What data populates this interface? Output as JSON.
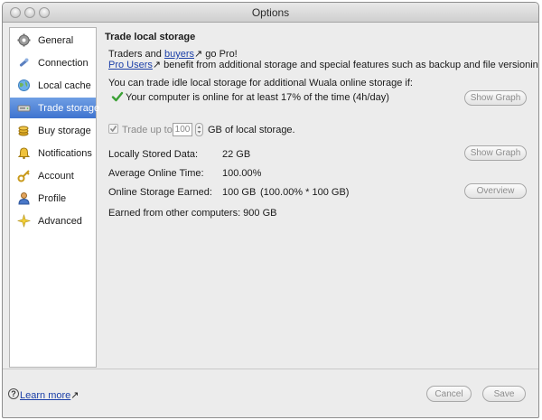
{
  "window": {
    "title": "Options"
  },
  "sidebar": {
    "items": [
      {
        "label": "General",
        "icon": "gear-icon"
      },
      {
        "label": "Connection",
        "icon": "satellite-icon"
      },
      {
        "label": "Local cache",
        "icon": "globe-icon"
      },
      {
        "label": "Trade storage",
        "icon": "drive-icon"
      },
      {
        "label": "Buy storage",
        "icon": "coins-icon"
      },
      {
        "label": "Notifications",
        "icon": "bell-icon"
      },
      {
        "label": "Account",
        "icon": "key-icon"
      },
      {
        "label": "Profile",
        "icon": "person-icon"
      },
      {
        "label": "Advanced",
        "icon": "sparkle-icon"
      }
    ],
    "selected": "Trade storage"
  },
  "main": {
    "heading": "Trade local storage",
    "intro_prefix": "Traders and ",
    "intro_link": "buyers",
    "intro_suffix": " go Pro!",
    "pro_link": "Pro Users",
    "pro_suffix": " benefit from additional storage and special features such as backup and file versioning.",
    "trade_condition": "You can trade idle local storage for additional Wuala online storage if:",
    "online_status": "Your computer is online for at least 17% of the time (4h/day)",
    "show_graph_label": "Show Graph",
    "trade_checkbox_label": "Trade up to",
    "trade_amount": "100",
    "trade_unit": "GB of local storage.",
    "stats": [
      {
        "label": "Locally Stored Data:",
        "value": "22 GB"
      },
      {
        "label": "Average Online Time:",
        "value": "100.00%"
      },
      {
        "label": "Online Storage Earned:",
        "value": "100 GB",
        "detail": "(100.00% * 100 GB)"
      }
    ],
    "overview_label": "Overview",
    "earned_other": "Earned from other computers: 900 GB"
  },
  "footer": {
    "help_icon_glyph": "?",
    "learn_more": "Learn more",
    "cancel_label": "Cancel",
    "save_label": "Save"
  },
  "colors": {
    "selection": "#3f73cf",
    "link": "#1b3fa8",
    "check": "#3aa034"
  }
}
